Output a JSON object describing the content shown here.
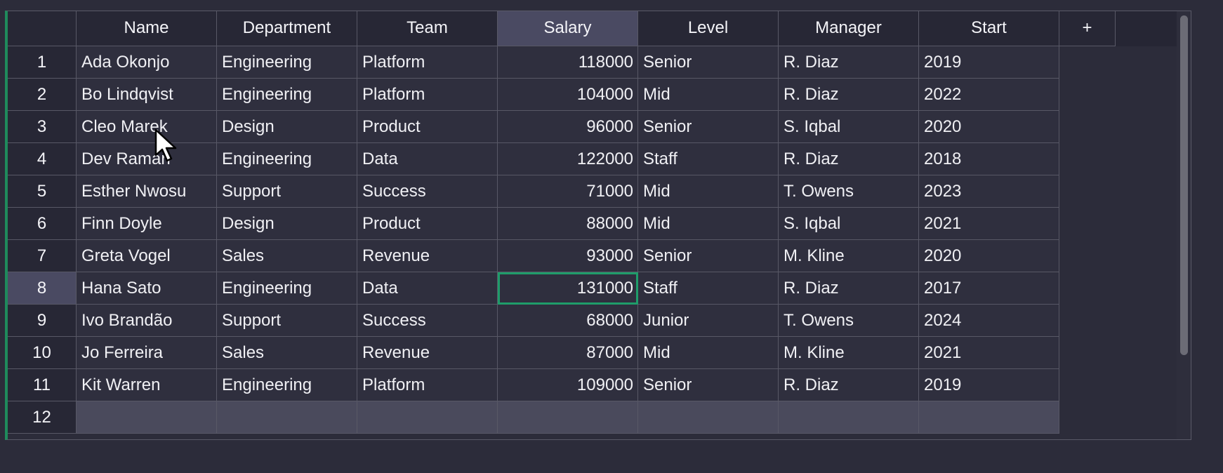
{
  "grid": {
    "add_column_label": "+",
    "columns": [
      "Name",
      "Department",
      "Team",
      "Salary",
      "Level",
      "Manager",
      "Start"
    ],
    "selected_column": "Salary",
    "selected_row": "8",
    "rows": [
      {
        "num": "1",
        "cells": [
          "Ada Okonjo",
          "Engineering",
          "Platform",
          "118000",
          "Senior",
          "R. Diaz",
          "2019"
        ]
      },
      {
        "num": "2",
        "cells": [
          "Bo Lindqvist",
          "Engineering",
          "Platform",
          "104000",
          "Mid",
          "R. Diaz",
          "2022"
        ]
      },
      {
        "num": "3",
        "cells": [
          "Cleo Marek",
          "Design",
          "Product",
          "96000",
          "Senior",
          "S. Iqbal",
          "2020"
        ]
      },
      {
        "num": "4",
        "cells": [
          "Dev Raman",
          "Engineering",
          "Data",
          "122000",
          "Staff",
          "R. Diaz",
          "2018"
        ]
      },
      {
        "num": "5",
        "cells": [
          "Esther Nwosu",
          "Support",
          "Success",
          "71000",
          "Mid",
          "T. Owens",
          "2023"
        ]
      },
      {
        "num": "6",
        "cells": [
          "Finn Doyle",
          "Design",
          "Product",
          "88000",
          "Mid",
          "S. Iqbal",
          "2021"
        ]
      },
      {
        "num": "7",
        "cells": [
          "Greta Vogel",
          "Sales",
          "Revenue",
          "93000",
          "Senior",
          "M. Kline",
          "2020"
        ]
      },
      {
        "num": "8",
        "cells": [
          "Hana Sato",
          "Engineering",
          "Data",
          "131000",
          "Staff",
          "R. Diaz",
          "2017"
        ]
      },
      {
        "num": "9",
        "cells": [
          "Ivo Brandão",
          "Support",
          "Success",
          "68000",
          "Junior",
          "T. Owens",
          "2024"
        ]
      },
      {
        "num": "10",
        "cells": [
          "Jo Ferreira",
          "Sales",
          "Revenue",
          "87000",
          "Mid",
          "M. Kline",
          "2021"
        ]
      },
      {
        "num": "11",
        "cells": [
          "Kit Warren",
          "Engineering",
          "Platform",
          "109000",
          "Senior",
          "R. Diaz",
          "2019"
        ]
      },
      {
        "num": "12",
        "cells": [
          "",
          "",
          "",
          "",
          "",
          "",
          ""
        ]
      }
    ],
    "active_cell": {
      "row": "8",
      "column": "Salary"
    }
  },
  "colors": {
    "background": "#2c2c3a",
    "cell": "#2f2f3e",
    "header": "#272735",
    "selected_header": "#4a4a62",
    "active_cell_border": "#1f9c6a",
    "frame_accent": "#1f8a5c",
    "empty_row": "#4a4a5c"
  },
  "icons": {
    "pointer": "mouse-pointer-icon",
    "add_column": "plus-icon"
  }
}
